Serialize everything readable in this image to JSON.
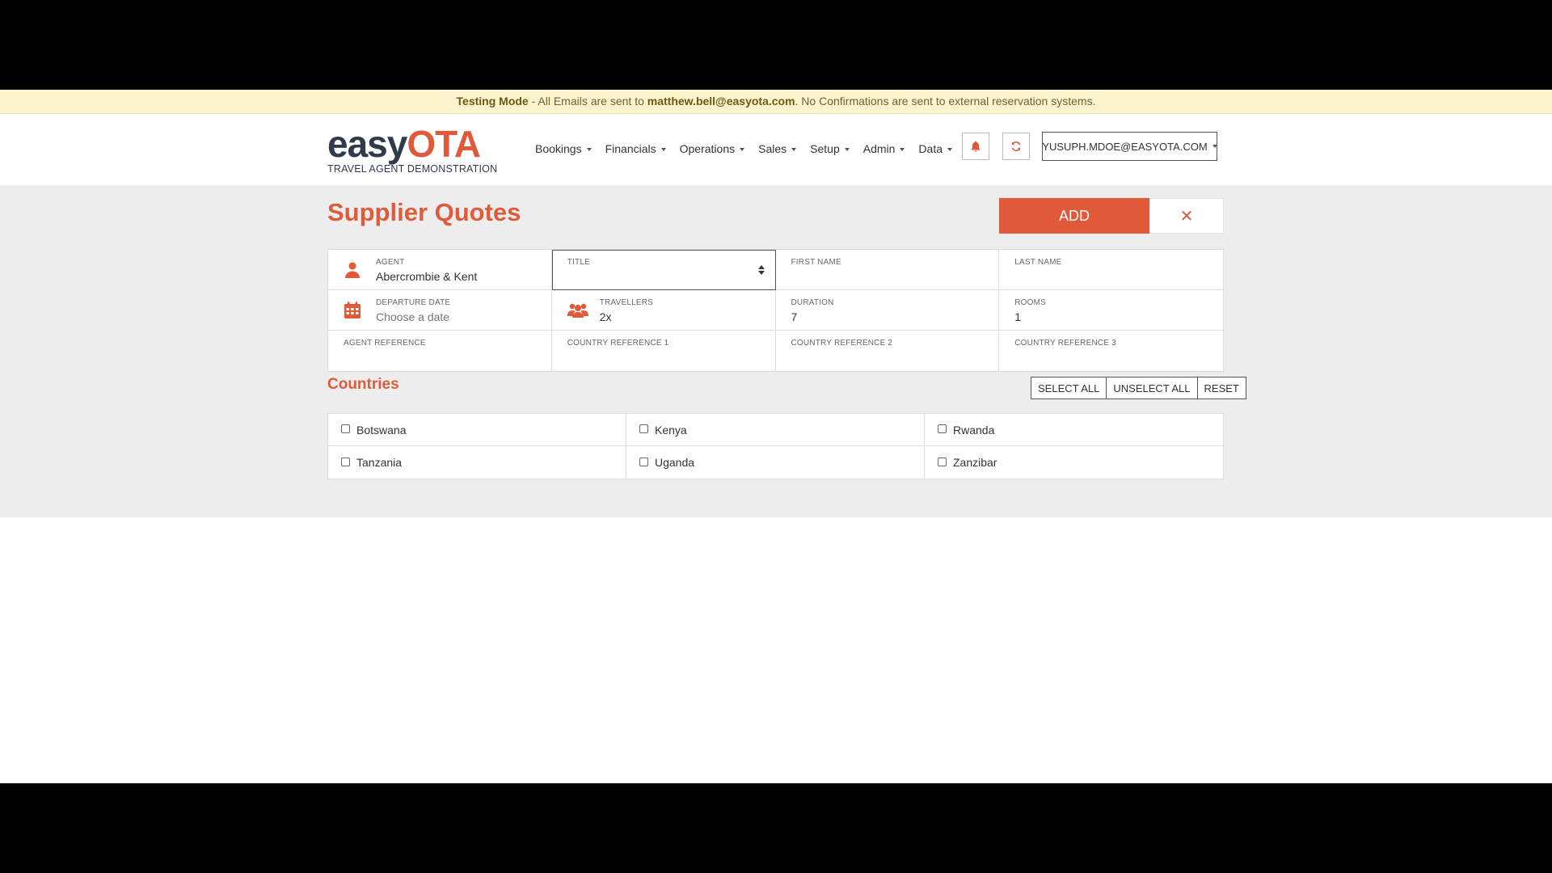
{
  "banner": {
    "mode": "Testing Mode",
    "text_before": " - All Emails are sent to ",
    "email": "matthew.bell@easyota.com",
    "text_after": ". No Confirmations are sent to external reservation systems."
  },
  "logo": {
    "main_part1": "easy",
    "main_part2": "OTA",
    "subtitle": "TRAVEL AGENT DEMONSTRATION"
  },
  "nav": [
    "Bookings",
    "Financials",
    "Operations",
    "Sales",
    "Setup",
    "Admin",
    "Data"
  ],
  "header": {
    "bell_icon": "bell-icon",
    "refresh_icon": "refresh-icon",
    "user": "YUSUPH.MDOE@EASYOTA.COM"
  },
  "page": {
    "title": "Supplier Quotes",
    "add_label": "ADD",
    "close_label": "✕"
  },
  "form": {
    "agent": {
      "label": "AGENT",
      "value": "Abercrombie & Kent"
    },
    "title": {
      "label": "TITLE",
      "value": ""
    },
    "first_name": {
      "label": "FIRST NAME",
      "value": ""
    },
    "last_name": {
      "label": "LAST NAME",
      "value": ""
    },
    "departure_date": {
      "label": "DEPARTURE DATE",
      "placeholder": "Choose a date"
    },
    "travellers": {
      "label": "TRAVELLERS",
      "value": "2x"
    },
    "duration": {
      "label": "DURATION",
      "value": "7"
    },
    "rooms": {
      "label": "ROOMS",
      "value": "1"
    },
    "agent_reference": {
      "label": "AGENT REFERENCE",
      "value": ""
    },
    "country_ref_1": {
      "label": "COUNTRY REFERENCE 1",
      "value": ""
    },
    "country_ref_2": {
      "label": "COUNTRY REFERENCE 2",
      "value": ""
    },
    "country_ref_3": {
      "label": "COUNTRY REFERENCE 3",
      "value": ""
    }
  },
  "countries": {
    "title": "Countries",
    "select_all": "SELECT ALL",
    "unselect_all": "UNSELECT ALL",
    "reset": "RESET",
    "items": [
      "Botswana",
      "Kenya",
      "Rwanda",
      "Tanzania",
      "Uganda",
      "Zanzibar"
    ]
  },
  "colors": {
    "accent": "#e05a3a",
    "banner_bg": "#fcf3cf",
    "content_bg": "#ededed"
  }
}
